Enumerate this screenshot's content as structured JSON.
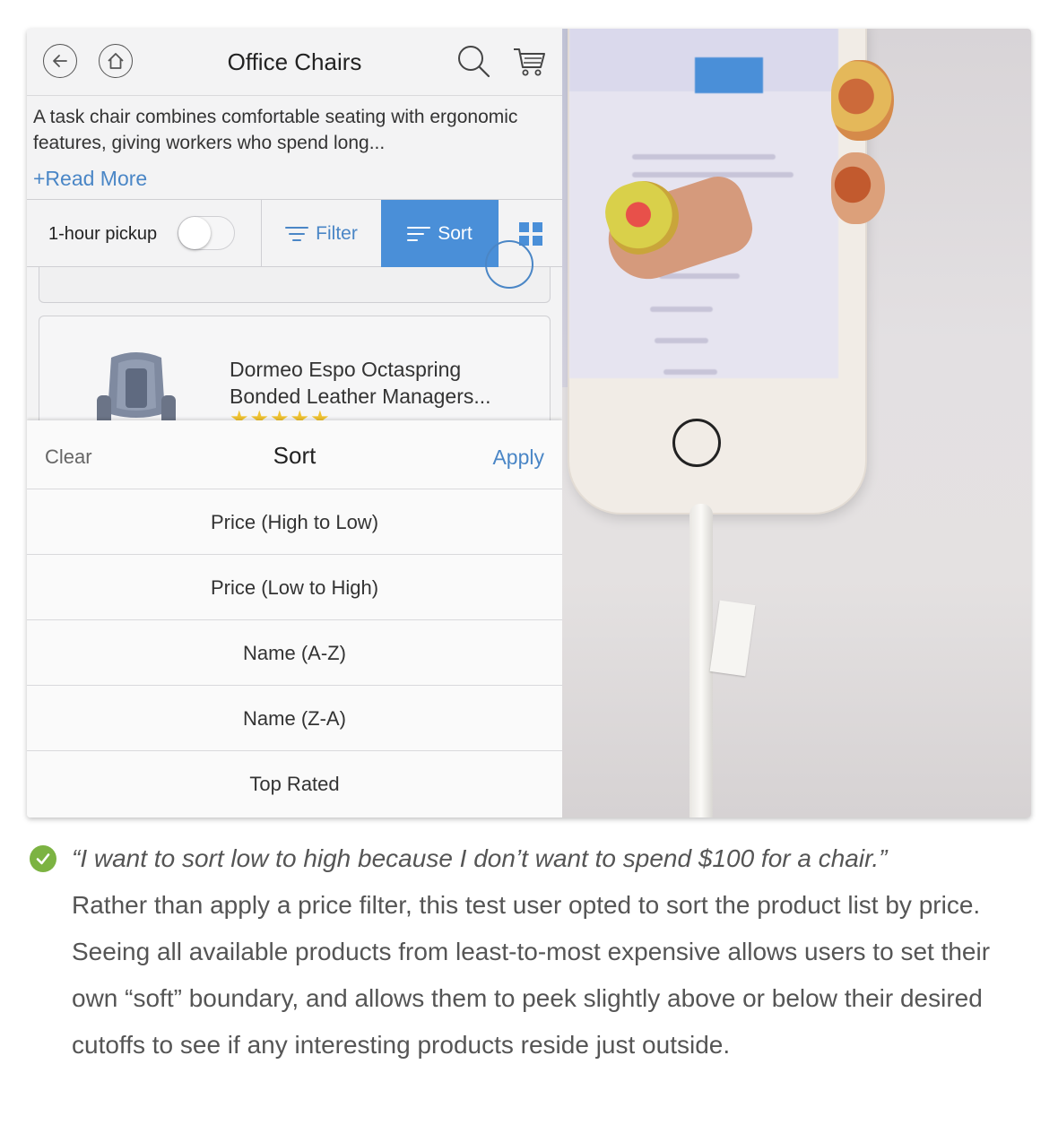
{
  "app": {
    "title": "Office Chairs",
    "description": "A task chair combines comfortable seating with ergonomic features, giving workers who spend long...",
    "read_more": "+Read More",
    "toolbar": {
      "pickup_label": "1-hour pickup",
      "pickup_toggle_on": false,
      "filter_label": "Filter",
      "sort_label": "Sort"
    },
    "product": {
      "name": "Dormeo Espo Octaspring Bonded Leather Managers...",
      "stars": "★★★★★"
    },
    "sort_sheet": {
      "clear": "Clear",
      "title": "Sort",
      "apply": "Apply",
      "options": [
        "Price (High to Low)",
        "Price (Low to High)",
        "Name (A-Z)",
        "Name (Z-A)",
        "Top Rated"
      ]
    }
  },
  "caption": {
    "quote": "“I want to sort low to high because I don’t want to spend $100 for a chair.”",
    "body": "Rather than apply a price filter, this test user opted to sort the product list by price. Seeing all available products from least-to-most expensive allows users to set their own “soft” boundary, and allows them to peek slightly above or below their desired cutoffs to see if any interesting products reside just outside."
  },
  "colors": {
    "accent": "#4a8fd8",
    "link": "#4a86c6",
    "success": "#7cb342",
    "star": "#f0c230"
  },
  "icons": [
    "back-icon",
    "home-icon",
    "search-icon",
    "cart-icon",
    "filter-icon",
    "sort-icon",
    "grid-icon",
    "check-icon"
  ]
}
